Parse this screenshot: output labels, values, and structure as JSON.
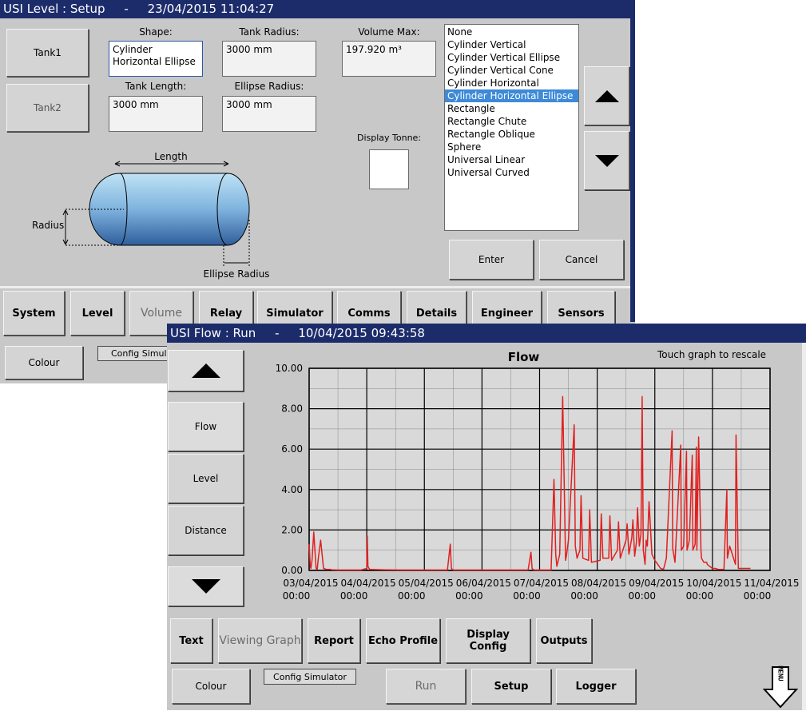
{
  "setup_window": {
    "title": "USI Level : Setup     -     23/04/2015 11:04:27",
    "tank1_label": "Tank1",
    "tank2_label": "Tank2",
    "shape_label": "Shape:",
    "shape_value_line1": "Cylinder",
    "shape_value_line2": "Horizontal Ellipse",
    "tank_radius_label": "Tank Radius:",
    "tank_radius_value": "3000 mm",
    "volume_max_label": "Volume Max:",
    "volume_max_value": "197.920 m³",
    "tank_length_label": "Tank Length:",
    "tank_length_value": "3000 mm",
    "ellipse_radius_label": "Ellipse Radius:",
    "ellipse_radius_value": "3000 mm",
    "display_tonne_label": "Display Tonne:",
    "diagram": {
      "length_label": "Length",
      "radius_label": "Radius",
      "ellipse_radius_label": "Ellipse Radius"
    },
    "shape_options": [
      "None",
      "Cylinder Vertical",
      "Cylinder Vertical Ellipse",
      "Cylinder Vertical Cone",
      "Cylinder Horizontal",
      "Cylinder Horizontal Ellipse",
      "Rectangle",
      "Rectangle Chute",
      "Rectangle Oblique",
      "Sphere",
      "Universal Linear",
      "Universal Curved"
    ],
    "selected_option": "Cylinder Horizontal Ellipse",
    "enter_label": "Enter",
    "cancel_label": "Cancel",
    "tabs": {
      "system": "System",
      "level": "Level",
      "volume": "Volume",
      "relay": "Relay",
      "simulator": "Simulator",
      "comms": "Comms",
      "details": "Details",
      "engineer": "Engineer",
      "sensors": "Sensors"
    },
    "colour_label": "Colour",
    "config_simulator_label": "Config Simulat"
  },
  "flow_window": {
    "title": "USI Flow : Run     -     10/04/2015 09:43:58",
    "side_buttons": {
      "flow": "Flow",
      "level": "Level",
      "distance": "Distance"
    },
    "rescale_hint": "Touch graph to rescale",
    "tabs": {
      "text": "Text",
      "viewing_graph": "Viewing Graph",
      "report": "Report",
      "echo_profile": "Echo Profile",
      "display_config": "Display Config",
      "outputs": "Outputs"
    },
    "colour_label": "Colour",
    "config_simulator_label": "Config Simulator",
    "run_label": "Run",
    "setup_label": "Setup",
    "logger_label": "Logger",
    "menu_label": "MENU"
  },
  "chart_data": {
    "type": "line",
    "title": "Flow",
    "ylim": [
      0,
      10
    ],
    "yticks": [
      "0.00",
      "2.00",
      "4.00",
      "6.00",
      "8.00",
      "10.00"
    ],
    "xlim": [
      0,
      8
    ],
    "xticks_date": [
      "03/04/2015",
      "04/04/2015",
      "05/04/2015",
      "06/04/2015",
      "07/04/2015",
      "08/04/2015",
      "09/04/2015",
      "10/04/2015",
      "11/04/2015"
    ],
    "xticks_time": [
      "00:00",
      "00:00",
      "00:00",
      "00:00",
      "00:00",
      "00:00",
      "00:00",
      "00:00",
      "00:00"
    ],
    "grid": true,
    "line_color": "#e02020",
    "series": [
      {
        "x": [
          0,
          0.02,
          0.03,
          0.05,
          0.08,
          0.12,
          0.14,
          0.16,
          0.2,
          0.25,
          0.3,
          0.34,
          0.36,
          0.4,
          0.5,
          0.6,
          0.7,
          0.8,
          0.9,
          1.0,
          1.01,
          1.02,
          1.05,
          1.3,
          1.6,
          2.0,
          2.4,
          2.45,
          2.47,
          2.5,
          2.9,
          3.2,
          3.5,
          3.8,
          3.85,
          3.87,
          3.9,
          4.2,
          4.25,
          4.28,
          4.3,
          4.35,
          4.4,
          4.45,
          4.47,
          4.5,
          4.6,
          4.62,
          4.65,
          4.7,
          4.72,
          4.75,
          4.85,
          4.87,
          4.9,
          5.05,
          5.07,
          5.1,
          5.2,
          5.22,
          5.25,
          5.35,
          5.37,
          5.4,
          5.5,
          5.52,
          5.55,
          5.6,
          5.62,
          5.65,
          5.68,
          5.7,
          5.73,
          5.76,
          5.78,
          5.8,
          5.83,
          5.85,
          5.87,
          5.9,
          5.95,
          6.0,
          6.05,
          6.1,
          6.15,
          6.2,
          6.3,
          6.31,
          6.35,
          6.45,
          6.46,
          6.5,
          6.55,
          6.56,
          6.6,
          6.65,
          6.66,
          6.7,
          6.72,
          6.73,
          6.76,
          6.8,
          6.81,
          6.85,
          6.9,
          6.91,
          6.95,
          7.0,
          7.05,
          7.1,
          7.2,
          7.25,
          7.26,
          7.3,
          7.4,
          7.41,
          7.45,
          7.6,
          7.65,
          7.66
        ],
        "y": [
          1.3,
          0.2,
          0.1,
          0.5,
          1.9,
          0.1,
          0.05,
          0.6,
          1.5,
          0.1,
          0.05,
          0.05,
          0.05,
          0.03,
          0.02,
          0.02,
          0.02,
          0.02,
          0.02,
          0.1,
          1.7,
          0.2,
          0.05,
          0.03,
          0.02,
          0.02,
          0.02,
          1.3,
          0.1,
          0.02,
          0.02,
          0.02,
          0.02,
          0.02,
          0.9,
          0.1,
          0.02,
          0.02,
          4.5,
          0.8,
          0.2,
          0.8,
          8.6,
          0.5,
          0.8,
          1.5,
          7.2,
          1.2,
          0.6,
          1.0,
          3.7,
          0.6,
          0.5,
          3.0,
          0.4,
          0.5,
          2.8,
          0.6,
          0.6,
          2.7,
          0.5,
          1.0,
          2.4,
          0.6,
          1.5,
          2.3,
          0.8,
          1.6,
          2.5,
          0.7,
          1.4,
          3.1,
          1.2,
          1.8,
          8.6,
          1.0,
          0.3,
          1.5,
          1.2,
          3.4,
          0.8,
          0.5,
          0.3,
          0.1,
          0.05,
          0.6,
          6.9,
          1.1,
          0.4,
          6.2,
          1.0,
          1.2,
          5.9,
          1.0,
          1.5,
          5.7,
          1.0,
          1.3,
          6.1,
          1.0,
          6.6,
          1.0,
          0.6,
          0.4,
          0.4,
          0.3,
          0.2,
          0.1,
          0.1,
          0.05,
          0.05,
          4.0,
          0.6,
          1.2,
          0.3,
          6.7,
          0.1,
          0.1,
          0.1,
          0.1
        ]
      }
    ]
  }
}
